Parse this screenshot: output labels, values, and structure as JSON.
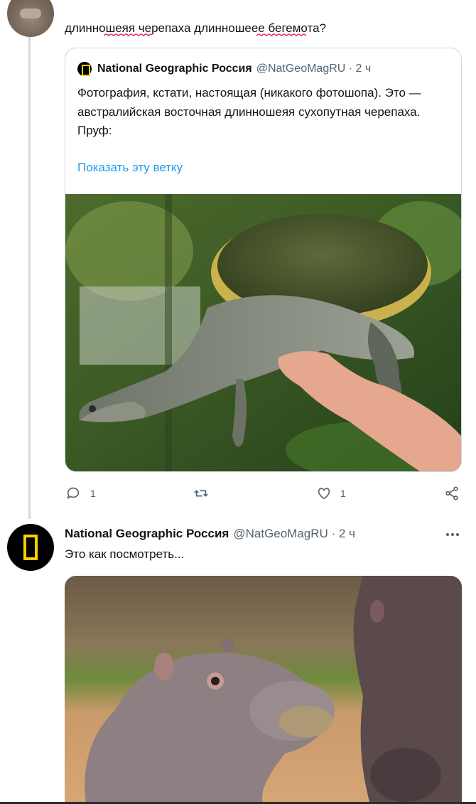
{
  "reply": {
    "text": "длинношеяя черепаха длинношеее бегемота?"
  },
  "quoted_tweet": {
    "author_name": "National Geographic Россия",
    "handle_time": "@NatGeoMagRU · 2 ч",
    "body": "Фотография, кстати, настоящая (никакого фотошопа). Это — австралийская восточная длинношеяя сухопутная черепаха. Пруф:",
    "show_thread": "Показать эту ветку",
    "photo_icon": "turtle-photo"
  },
  "actions": {
    "reply_count": "1",
    "retweet_count": "",
    "like_count": "1",
    "icons": [
      "reply-icon",
      "retweet-icon",
      "like-icon",
      "share-icon"
    ]
  },
  "tweet2": {
    "author_name": "National Geographic Россия",
    "handle_time": "@NatGeoMagRU · 2 ч",
    "text": "Это как посмотреть...",
    "more_icon": "more-icon",
    "photo_icon": "hippo-photo"
  },
  "colors": {
    "link": "#1d9bf0",
    "secondary_text": "#536471",
    "spellcheck": "#e0245e",
    "natgeo_yellow": "#ffce00",
    "border": "#cfd9de"
  }
}
